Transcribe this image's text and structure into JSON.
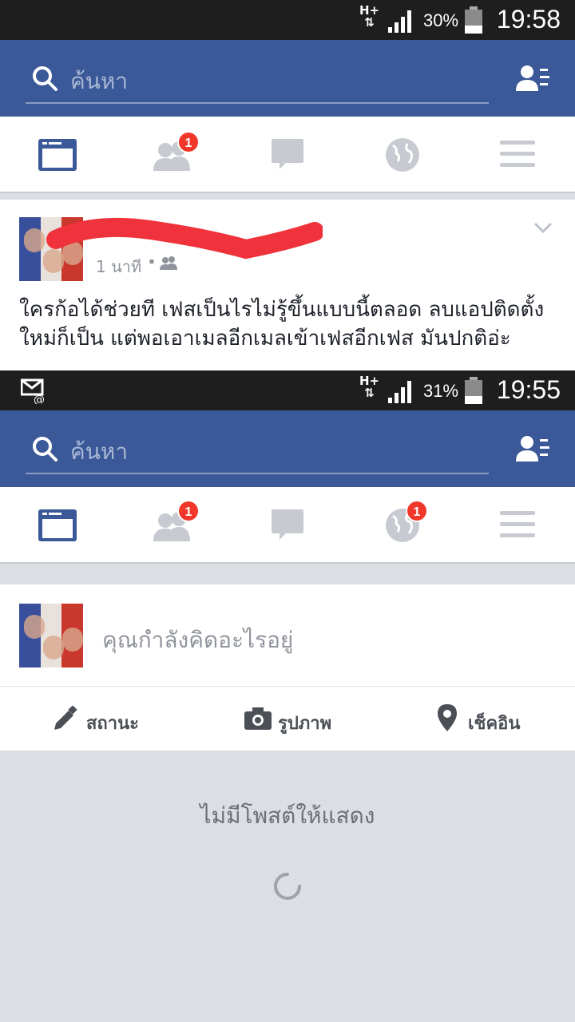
{
  "top_screen": {
    "status": {
      "network": "H+",
      "battery": "30%",
      "time": "19:58"
    },
    "search_placeholder": "ค้นหา",
    "nav": {
      "friends_badge": "1"
    },
    "post": {
      "timestamp": "1 นาที",
      "separator": "•",
      "text": "ใครก้อได้ช่วยที เฟสเป็นไรไม่รู้ขึ้นแบบนี้ตลอด ลบแอปติดตั้งใหม่ก็เป็น แต่พอเอาเมลอีกเมลเข้าเฟสอีกเฟส มันปกติอ่ะ"
    }
  },
  "bottom_screen": {
    "status": {
      "network": "H+",
      "battery": "31%",
      "time": "19:55"
    },
    "search_placeholder": "ค้นหา",
    "nav": {
      "friends_badge": "1",
      "notifications_badge": "1"
    },
    "composer": {
      "placeholder": "คุณกำลังคิดอะไรอยู่",
      "actions": {
        "status": "สถานะ",
        "photo": "รูปภาพ",
        "checkin": "เช็คอิน"
      }
    },
    "empty_message": "ไม่มีโพสต์ให้แสดง"
  },
  "colors": {
    "brand": "#3b5998",
    "badge": "#f0372a",
    "redaction": "#f0323c"
  }
}
